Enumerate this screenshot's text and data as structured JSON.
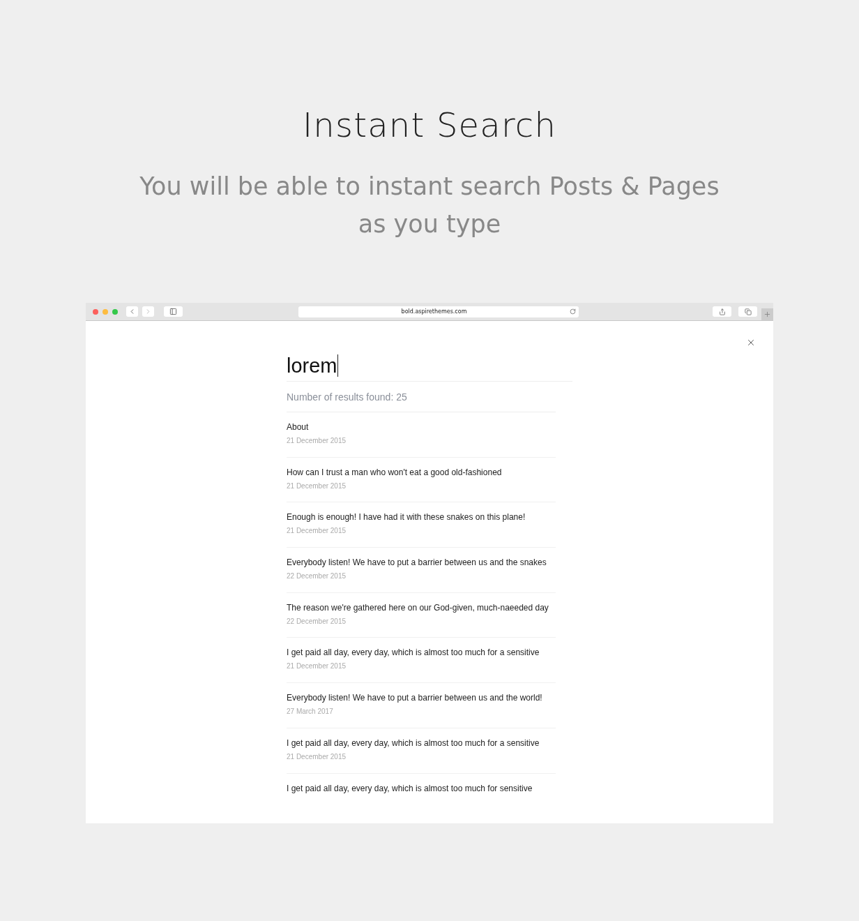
{
  "heading": "Instant Search",
  "subheading": "You will be able to instant search Posts & Pages as you type",
  "browser": {
    "url": "bold.aspirethemes.com"
  },
  "search": {
    "value": "lorem",
    "results_count": "Number of results found: 25"
  },
  "results": [
    {
      "title": "About",
      "date": "21 December 2015"
    },
    {
      "title": "How can I trust a man who won't eat a good old-fashioned",
      "date": "21 December 2015"
    },
    {
      "title": "Enough is enough! I have had it with these snakes on this plane!",
      "date": "21 December 2015"
    },
    {
      "title": "Everybody listen! We have to put a barrier between us and the snakes",
      "date": "22 December 2015"
    },
    {
      "title": "The reason we're gathered here on our God-given, much-naeeded day",
      "date": "22 December 2015"
    },
    {
      "title": "I get paid all day, every day, which is almost too much for a sensitive",
      "date": "21 December 2015"
    },
    {
      "title": "Everybody listen! We have to put a barrier between us and the world!",
      "date": "27 March 2017"
    },
    {
      "title": "I get paid all day, every day, which is almost too much for a sensitive",
      "date": "21 December 2015"
    },
    {
      "title": "I get paid all day, every day, which is almost too much for sensitive"
    }
  ]
}
